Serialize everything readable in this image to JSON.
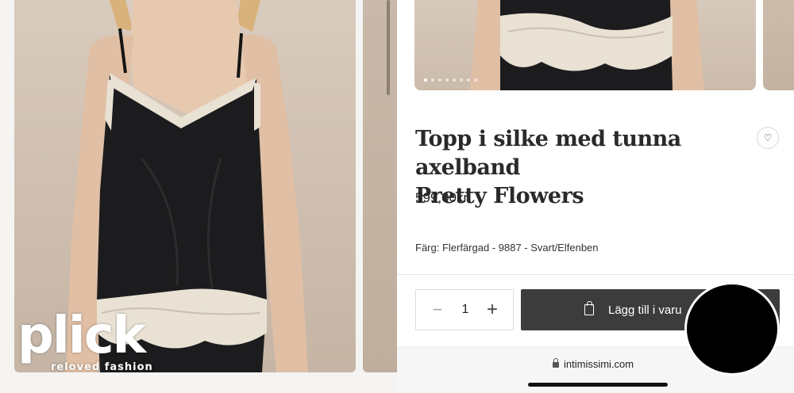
{
  "watermark": {
    "logo": "plick",
    "tagline": "reloved fashion"
  },
  "gallery": {
    "dot_count": 8,
    "active_dot": 0
  },
  "product": {
    "title_line1": "Topp i silke med tunna axelband",
    "title_line2": "Pretty Flowers",
    "price": "599,00kr",
    "color": "Färg: Flerfärgad - 9887 - Svart/Elfenben"
  },
  "cart": {
    "quantity": "1",
    "minus": "−",
    "plus": "+",
    "add_label": "Lägg till i varu"
  },
  "browser": {
    "url": "intimissimi.com"
  },
  "colors": {
    "silk": "#1c1c1e",
    "lace": "#e9e2d4",
    "button": "#3c3c3c",
    "background": "#d9cbbd"
  }
}
